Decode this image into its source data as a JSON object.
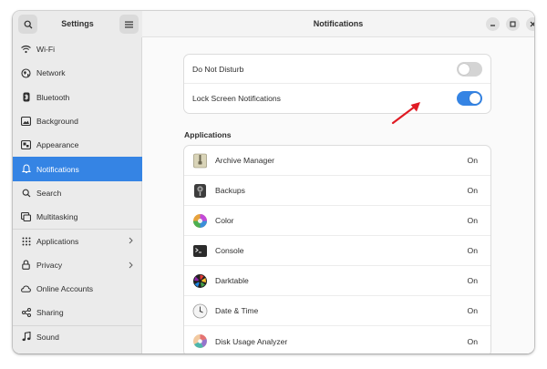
{
  "sidebar": {
    "title": "Settings",
    "items": [
      {
        "label": "Wi-Fi",
        "icon": "wifi-icon"
      },
      {
        "label": "Network",
        "icon": "network-icon"
      },
      {
        "label": "Bluetooth",
        "icon": "bluetooth-icon"
      },
      {
        "label": "Background",
        "icon": "background-icon"
      },
      {
        "label": "Appearance",
        "icon": "appearance-icon"
      },
      {
        "label": "Notifications",
        "icon": "bell-icon",
        "active": true
      },
      {
        "label": "Search",
        "icon": "search-icon"
      },
      {
        "label": "Multitasking",
        "icon": "multitasking-icon"
      },
      {
        "label": "Applications",
        "icon": "grid-icon",
        "chevron": true
      },
      {
        "label": "Privacy",
        "icon": "lock-icon",
        "chevron": true
      },
      {
        "label": "Online Accounts",
        "icon": "cloud-icon"
      },
      {
        "label": "Sharing",
        "icon": "share-icon"
      },
      {
        "label": "Sound",
        "icon": "music-note-icon"
      }
    ]
  },
  "main": {
    "title": "Notifications",
    "settings": [
      {
        "label": "Do Not Disturb",
        "state": "off"
      },
      {
        "label": "Lock Screen Notifications",
        "state": "on"
      }
    ],
    "applications_heading": "Applications",
    "apps": [
      {
        "name": "Archive Manager",
        "status": "On",
        "icon": "archive-manager-icon"
      },
      {
        "name": "Backups",
        "status": "On",
        "icon": "backups-icon"
      },
      {
        "name": "Color",
        "status": "On",
        "icon": "color-icon"
      },
      {
        "name": "Console",
        "status": "On",
        "icon": "console-icon"
      },
      {
        "name": "Darktable",
        "status": "On",
        "icon": "darktable-icon"
      },
      {
        "name": "Date & Time",
        "status": "On",
        "icon": "clock-icon"
      },
      {
        "name": "Disk Usage Analyzer",
        "status": "On",
        "icon": "disk-usage-icon"
      }
    ]
  },
  "colors": {
    "accent": "#3584e4",
    "annotation_arrow": "#e01b24"
  }
}
